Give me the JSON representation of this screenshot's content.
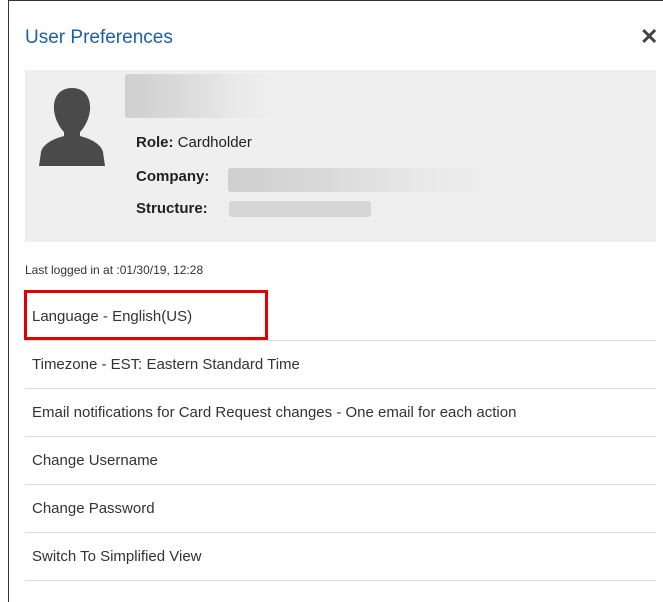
{
  "dialog": {
    "title": "User Preferences",
    "close_glyph": "✕",
    "close_icon": "close-icon"
  },
  "profile": {
    "avatar_icon": "person-silhouette-icon",
    "role_label": "Role:",
    "role_value": "Cardholder",
    "company_label": "Company:",
    "structure_label": "Structure:"
  },
  "last_login": "Last logged in at :01/30/19, 12:28",
  "menu": {
    "items": [
      {
        "label": "Language - English(US)"
      },
      {
        "label": "Timezone - EST: Eastern Standard Time"
      },
      {
        "label": "Email notifications for Card Request changes - One email for each action"
      },
      {
        "label": "Change Username"
      },
      {
        "label": "Change Password"
      },
      {
        "label": "Switch To Simplified View"
      }
    ]
  },
  "colors": {
    "title": "#1f5fa6",
    "highlight_border": "#e00000",
    "profile_background": "#efefef"
  }
}
